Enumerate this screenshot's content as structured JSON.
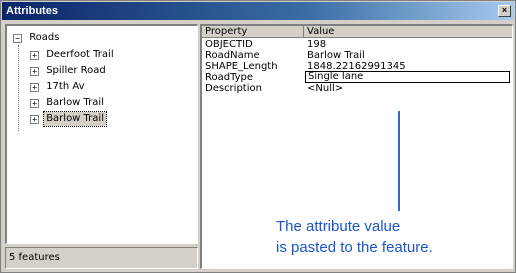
{
  "window": {
    "title": "Attributes",
    "close_glyph": "×"
  },
  "tree": {
    "root": {
      "label": "Roads",
      "expander": "−"
    },
    "items": [
      {
        "label": "Deerfoot Trail",
        "expander": "+",
        "selected": false
      },
      {
        "label": "Spiller Road",
        "expander": "+",
        "selected": false
      },
      {
        "label": "17th Av",
        "expander": "+",
        "selected": false
      },
      {
        "label": "Barlow Trail",
        "expander": "+",
        "selected": false
      },
      {
        "label": "Barlow Trail",
        "expander": "+",
        "selected": true
      }
    ]
  },
  "status": {
    "text": "5 features"
  },
  "grid": {
    "headers": {
      "property": "Property",
      "value": "Value"
    },
    "rows": [
      {
        "property": "OBJECTID",
        "value": "198"
      },
      {
        "property": "RoadName",
        "value": "Barlow Trail"
      },
      {
        "property": "SHAPE_Length",
        "value": "1848.22162991345"
      },
      {
        "property": "RoadType",
        "value": "Single lane"
      },
      {
        "property": "Description",
        "value": "<Null>"
      }
    ]
  },
  "annotation": {
    "line1": "The attribute value",
    "line2": "is pasted to the feature."
  },
  "colors": {
    "title_gradient_start": "#0a246a",
    "title_gradient_end": "#a6caf0",
    "annotation": "#1a56c7",
    "arrow": "#2f6bd3"
  }
}
